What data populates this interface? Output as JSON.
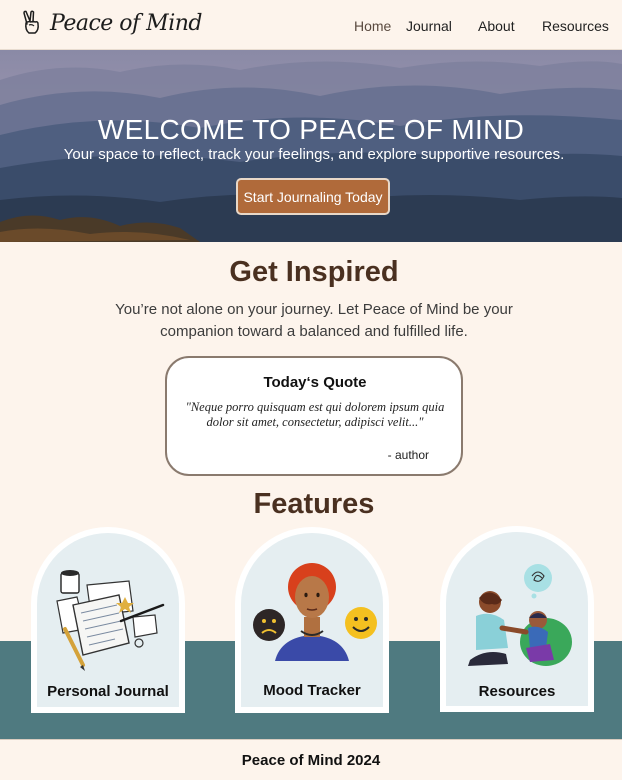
{
  "brand": {
    "name": "Peace of Mind",
    "icon": "peace-hand-icon"
  },
  "nav": {
    "items": [
      {
        "label": "Home"
      },
      {
        "label": "Journal"
      },
      {
        "label": "About"
      },
      {
        "label": "Resources"
      }
    ]
  },
  "hero": {
    "title": "WELCOME TO PEACE OF MIND",
    "subtitle": "Your space to reflect, track your feelings, and explore supportive resources.",
    "cta_label": "Start Journaling Today"
  },
  "inspired": {
    "title": "Get Inspired",
    "text": "You’re not alone on your journey. Let Peace of Mind be your companion toward a balanced and fulfilled life."
  },
  "quote": {
    "title": "Today‘s Quote",
    "body": "\"Neque porro quisquam est qui dolorem ipsum quia dolor sit amet, consectetur, adipisci velit...\"",
    "author": "- author"
  },
  "features": {
    "title": "Features",
    "items": [
      {
        "label": "Personal Journal",
        "icon": "journal-illustration"
      },
      {
        "label": "Mood Tracker",
        "icon": "mood-illustration"
      },
      {
        "label": "Resources",
        "icon": "support-illustration"
      }
    ]
  },
  "footer": {
    "text": "Peace of Mind 2024"
  },
  "colors": {
    "background": "#fdf4ec",
    "accent": "#b06a3a",
    "teal": "#4f7a80",
    "heading": "#4a3020"
  }
}
